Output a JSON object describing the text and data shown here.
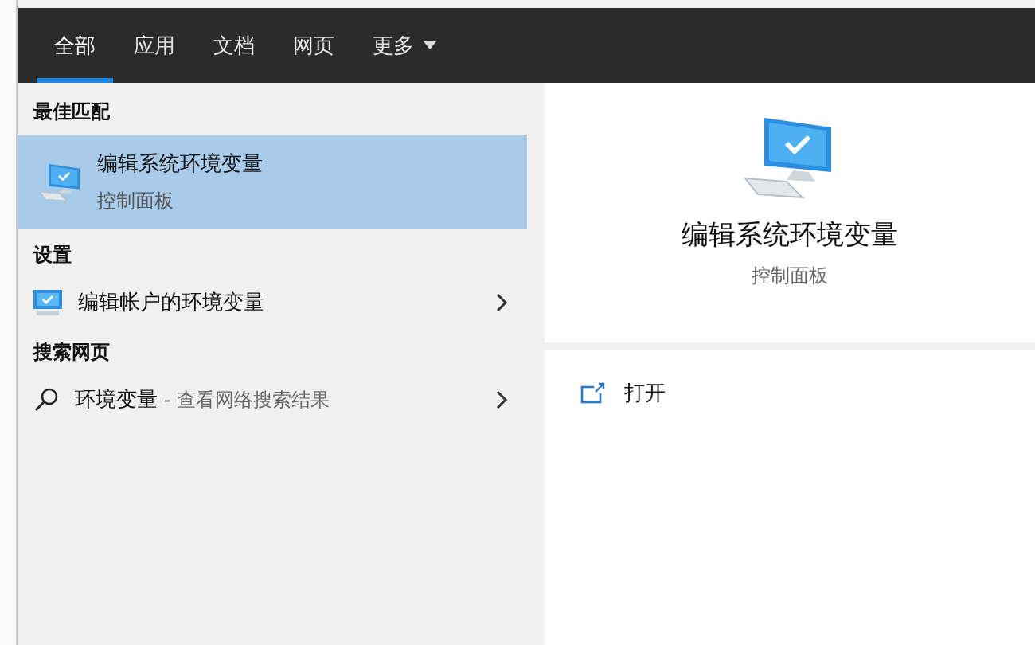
{
  "tabs": [
    {
      "label": "全部",
      "selected": true,
      "kind": "plain"
    },
    {
      "label": "应用",
      "selected": false,
      "kind": "plain"
    },
    {
      "label": "文档",
      "selected": false,
      "kind": "plain"
    },
    {
      "label": "网页",
      "selected": false,
      "kind": "plain"
    },
    {
      "label": "更多",
      "selected": false,
      "kind": "dropdown"
    }
  ],
  "sections": [
    {
      "header": "最佳匹配",
      "items": [
        {
          "kind": "app",
          "title": "编辑系统环境变量",
          "subtitle": "控制面板",
          "selected": true
        }
      ]
    },
    {
      "header": "设置",
      "items": [
        {
          "kind": "setting",
          "title": "编辑帐户的环境变量",
          "selected": false
        }
      ]
    },
    {
      "header": "搜索网页",
      "items": [
        {
          "kind": "web",
          "title": "环境变量",
          "hint": " - 查看网络搜索结果",
          "selected": false
        }
      ]
    }
  ],
  "preview": {
    "title": "编辑系统环境变量",
    "subtitle": "控制面板",
    "actions": [
      {
        "label": "打开"
      }
    ]
  }
}
